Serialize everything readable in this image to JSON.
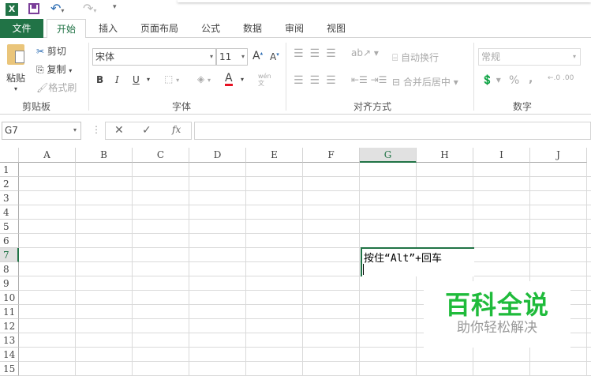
{
  "qat": {
    "app_icon": "excel-icon",
    "save": "save-icon",
    "undo": "undo-icon",
    "redo": "redo-icon",
    "customize": "customize-icon"
  },
  "tabs": [
    "文件",
    "开始",
    "插入",
    "页面布局",
    "公式",
    "数据",
    "审阅",
    "视图"
  ],
  "clipboard": {
    "paste": "粘贴",
    "cut": "剪切",
    "copy": "复制",
    "format_painter": "格式刷",
    "label": "剪贴板"
  },
  "font": {
    "name": "宋体",
    "size": "11",
    "label": "字体",
    "phonetic": "wén\n文",
    "bold": "B",
    "italic": "I",
    "underline": "U",
    "font_color": "#e81123"
  },
  "alignment": {
    "wrap": "自动换行",
    "merge": "合并后居中",
    "label": "对齐方式"
  },
  "number": {
    "format": "常规",
    "percent": "%",
    "comma": ",",
    "label": "数字"
  },
  "formula_bar": {
    "name_box": "G7",
    "cancel": "✕",
    "enter": "✓",
    "fx": "fx",
    "value": ""
  },
  "columns": [
    "A",
    "B",
    "C",
    "D",
    "E",
    "F",
    "G",
    "H",
    "I",
    "J"
  ],
  "rows": [
    "1",
    "2",
    "3",
    "4",
    "5",
    "6",
    "7",
    "8",
    "9",
    "10",
    "11",
    "12",
    "13",
    "14",
    "15"
  ],
  "active_cell": {
    "ref": "G7",
    "text": "按住“Alt”+回车"
  },
  "watermark": {
    "title": "百科全说",
    "subtitle": "助你轻松解决",
    "color": "#1fbb3b"
  },
  "colors": {
    "accent": "#217346"
  }
}
